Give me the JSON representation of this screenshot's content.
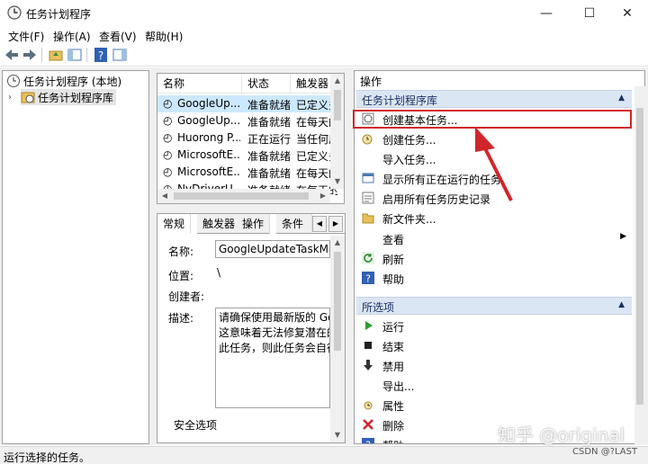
{
  "window": {
    "title": "任务计划程序",
    "controls": {
      "minimize": "—",
      "maximize": "☐",
      "close": "✕"
    }
  },
  "menubar": {
    "items": [
      "文件(F)",
      "操作(A)",
      "查看(V)",
      "帮助(H)"
    ]
  },
  "tree": {
    "root": "任务计划程序 (本地)",
    "child": "任务计划程序库"
  },
  "task_list": {
    "columns": [
      "名称",
      "状态",
      "触发器"
    ],
    "rows": [
      {
        "name": "GoogleUp...",
        "status": "准备就绪",
        "trigger": "已定义多"
      },
      {
        "name": "GoogleUp...",
        "status": "准备就绪",
        "trigger": "在每天的"
      },
      {
        "name": "Huorong P...",
        "status": "正在运行",
        "trigger": "当任何用"
      },
      {
        "name": "MicrosoftE...",
        "status": "准备就绪",
        "trigger": "已定义多"
      },
      {
        "name": "MicrosoftE...",
        "status": "准备就绪",
        "trigger": "在每天的"
      },
      {
        "name": "NvDriverU...",
        "status": "准备就绪",
        "trigger": "在每天的"
      }
    ]
  },
  "details": {
    "tabs": [
      "常规",
      "触发器",
      "操作",
      "条件"
    ],
    "labels": {
      "name": "名称:",
      "location": "位置:",
      "author": "创建者:",
      "description": "描述:",
      "security": "安全选项"
    },
    "values": {
      "name": "GoogleUpdateTaskMac",
      "location": "\\",
      "description_lines": [
        "请确保使用最新版的 Goog",
        "这意味着无法修复潜在的安",
        "此任务，则此任务会自行卸"
      ]
    }
  },
  "actions": {
    "title": "操作",
    "sections": [
      {
        "header": "任务计划程序库",
        "items": [
          "创建基本任务...",
          "创建任务...",
          "导入任务...",
          "显示所有正在运行的任务",
          "启用所有任务历史记录",
          "新文件夹...",
          "查看",
          "刷新",
          "帮助"
        ]
      },
      {
        "header": "所选项",
        "items": [
          "运行",
          "结束",
          "禁用",
          "导出...",
          "属性",
          "删除",
          "帮助"
        ]
      }
    ]
  },
  "status": {
    "text": "运行选择的任务。"
  },
  "watermark": {
    "main": "知乎 @original",
    "sub": "CSDN @?LAST"
  },
  "colors": {
    "highlight": "#d0262b",
    "section_header": "#dbe6f4",
    "selected_row": "#cce8ff"
  }
}
